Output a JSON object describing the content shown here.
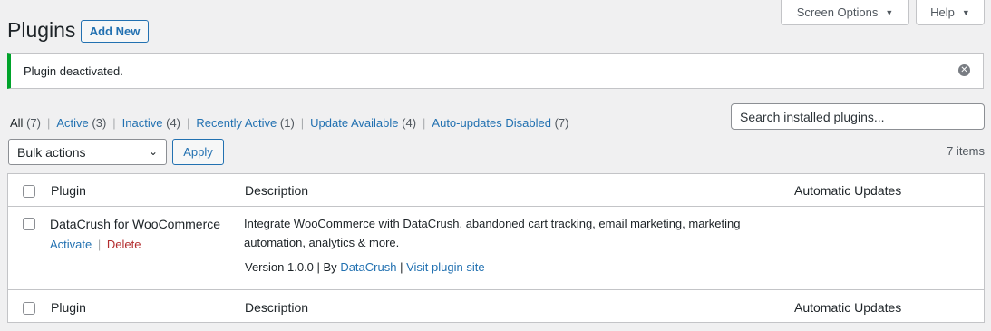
{
  "header": {
    "title": "Plugins",
    "add_new_label": "Add New",
    "screen_options_label": "Screen Options",
    "help_label": "Help"
  },
  "notice": {
    "message": "Plugin deactivated."
  },
  "filters": [
    {
      "label": "All",
      "count": "(7)"
    },
    {
      "label": "Active",
      "count": "(3)"
    },
    {
      "label": "Inactive",
      "count": "(4)"
    },
    {
      "label": "Recently Active",
      "count": "(1)"
    },
    {
      "label": "Update Available",
      "count": "(4)"
    },
    {
      "label": "Auto-updates Disabled",
      "count": "(7)"
    }
  ],
  "search": {
    "placeholder": "Search installed plugins..."
  },
  "bulk": {
    "selected": "Bulk actions",
    "apply_label": "Apply"
  },
  "items_count": "7 items",
  "table": {
    "columns": [
      "Plugin",
      "Description",
      "Automatic Updates"
    ],
    "rows": [
      {
        "name": "DataCrush for WooCommerce",
        "action_activate": "Activate",
        "action_delete": "Delete",
        "description_line1": "Integrate WooCommerce with DataCrush, abandoned cart tracking, email marketing, marketing",
        "description_line2": "automation, analytics & more.",
        "version": "Version 1.0.0",
        "by_label": "By",
        "author": "DataCrush",
        "visit_label": "Visit plugin site"
      }
    ]
  },
  "colors": {
    "accent": "#2271b1",
    "success": "#00a32a",
    "delete": "#b32d2e"
  }
}
